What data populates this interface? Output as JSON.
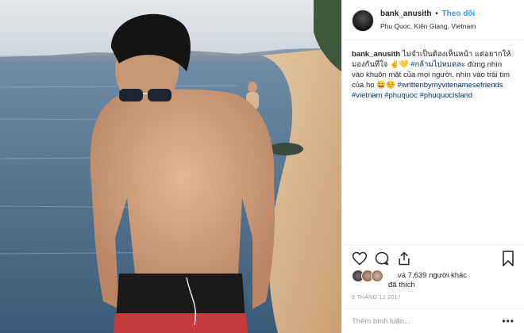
{
  "post": {
    "username": "bank_anusith",
    "separator": "•",
    "follow_label": "Theo dõi",
    "location": "Phu Quoc, Kiên Giang, Vietnam",
    "caption": {
      "username": "bank_anusith",
      "text1": "ไม่จำเป็นต้องเห็นหน้า แต่อยากให้มองกันที่ใจ ✌️💛",
      "hashtag1": "#กล้ามไปหมดละ",
      "text2": "đừng nhìn vào khuôn mặt của mọi người. nhìn vào trái tim của họ 😄☺️",
      "hashtag2": "#writtenbymyvitenamesefriends",
      "hashtag3": "#vietnam",
      "hashtag4": "#phuquoc",
      "hashtag5": "#phuquocisland"
    },
    "likes_line1": "và 7,639 người khác",
    "likes_line2": "đã thích",
    "date": "9 THÁNG 12 2017",
    "comment_placeholder": "Thêm bình luận...",
    "more_label": "•••"
  },
  "icons": {
    "heart": "heart-icon",
    "comment": "comment-icon",
    "share": "share-icon",
    "save": "bookmark-icon",
    "more": "more-options-icon"
  },
  "colors": {
    "accent": "#3897f0",
    "hashtag": "#003569",
    "muted": "#999999"
  }
}
